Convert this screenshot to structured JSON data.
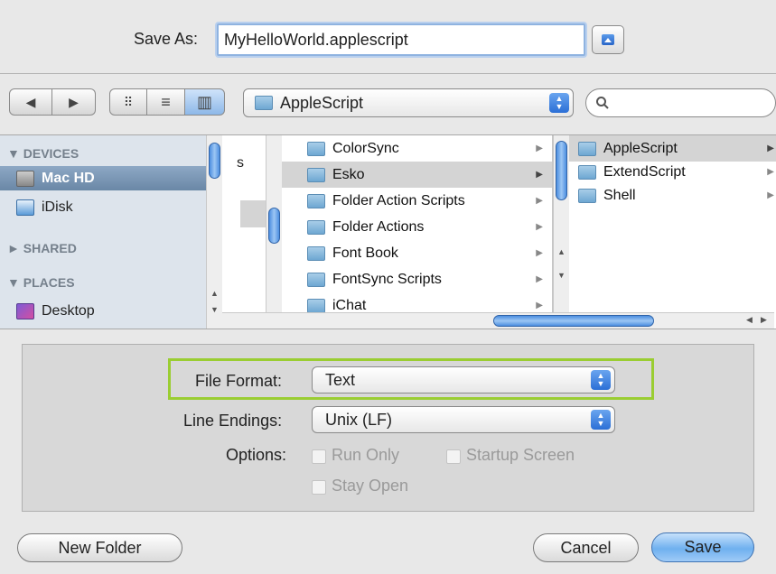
{
  "save_as": {
    "label": "Save As:",
    "value": "MyHelloWorld.applescript"
  },
  "toolbar": {
    "back_glyph": "◀",
    "forward_glyph": "▶",
    "icon_view_glyph": "⠿",
    "list_view_glyph": "≡",
    "column_view_glyph": "▥",
    "location": "AppleScript",
    "search_placeholder": ""
  },
  "sidebar": {
    "devices_header": "▼ DEVICES",
    "devices": [
      {
        "label": "Mac HD",
        "icon": "hard-disk-icon"
      },
      {
        "label": "iDisk",
        "icon": "idisk-icon"
      }
    ],
    "shared_header": "► SHARED",
    "places_header": "▼ PLACES",
    "places": [
      {
        "label": "Desktop",
        "icon": "desktop-icon"
      }
    ]
  },
  "browser": {
    "col1_fragment": "s",
    "col2": [
      "ColorSync",
      "Esko",
      "Folder Action Scripts",
      "Folder Actions",
      "Font Book",
      "FontSync Scripts",
      "iChat"
    ],
    "col3": [
      "AppleScript",
      "ExtendScript",
      "Shell"
    ],
    "arrow": "▶"
  },
  "options": {
    "file_format_label": "File Format:",
    "file_format_value": "Text",
    "line_endings_label": "Line Endings:",
    "line_endings_value": "Unix (LF)",
    "options_label": "Options:",
    "run_only": "Run Only",
    "startup_screen": "Startup Screen",
    "stay_open": "Stay Open",
    "highlight_color": "#9acd32"
  },
  "buttons": {
    "new_folder": "New Folder",
    "cancel": "Cancel",
    "save": "Save"
  }
}
